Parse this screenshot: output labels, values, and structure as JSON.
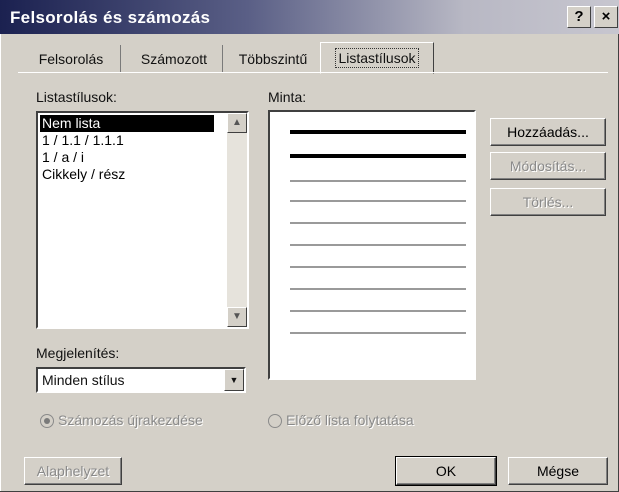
{
  "window": {
    "title": "Felsorolás és számozás",
    "help_label": "?",
    "close_label": "×"
  },
  "tabs": [
    {
      "label": "Felsorolás",
      "active": false
    },
    {
      "label": "Számozott",
      "active": false
    },
    {
      "label": "Többszintű",
      "active": false
    },
    {
      "label": "Listastílusok",
      "active": true
    }
  ],
  "styles_list": {
    "label": "Listastílusok:",
    "items": [
      "Nem lista",
      "1 / 1.1 / 1.1.1",
      "1 / a / i",
      "Cikkely / rész"
    ],
    "selected": "Nem lista"
  },
  "preview": {
    "label": "Minta:"
  },
  "side_buttons": {
    "add": "Hozzáadás...",
    "modify": "Módosítás...",
    "delete": "Törlés..."
  },
  "display": {
    "label": "Megjelenítés:",
    "value": "Minden stílus"
  },
  "numbering": {
    "restart": "Számozás újrakezdése",
    "continue": "Előző lista folytatása"
  },
  "footer": {
    "reset": "Alaphelyzet",
    "ok": "OK",
    "cancel": "Mégse"
  }
}
